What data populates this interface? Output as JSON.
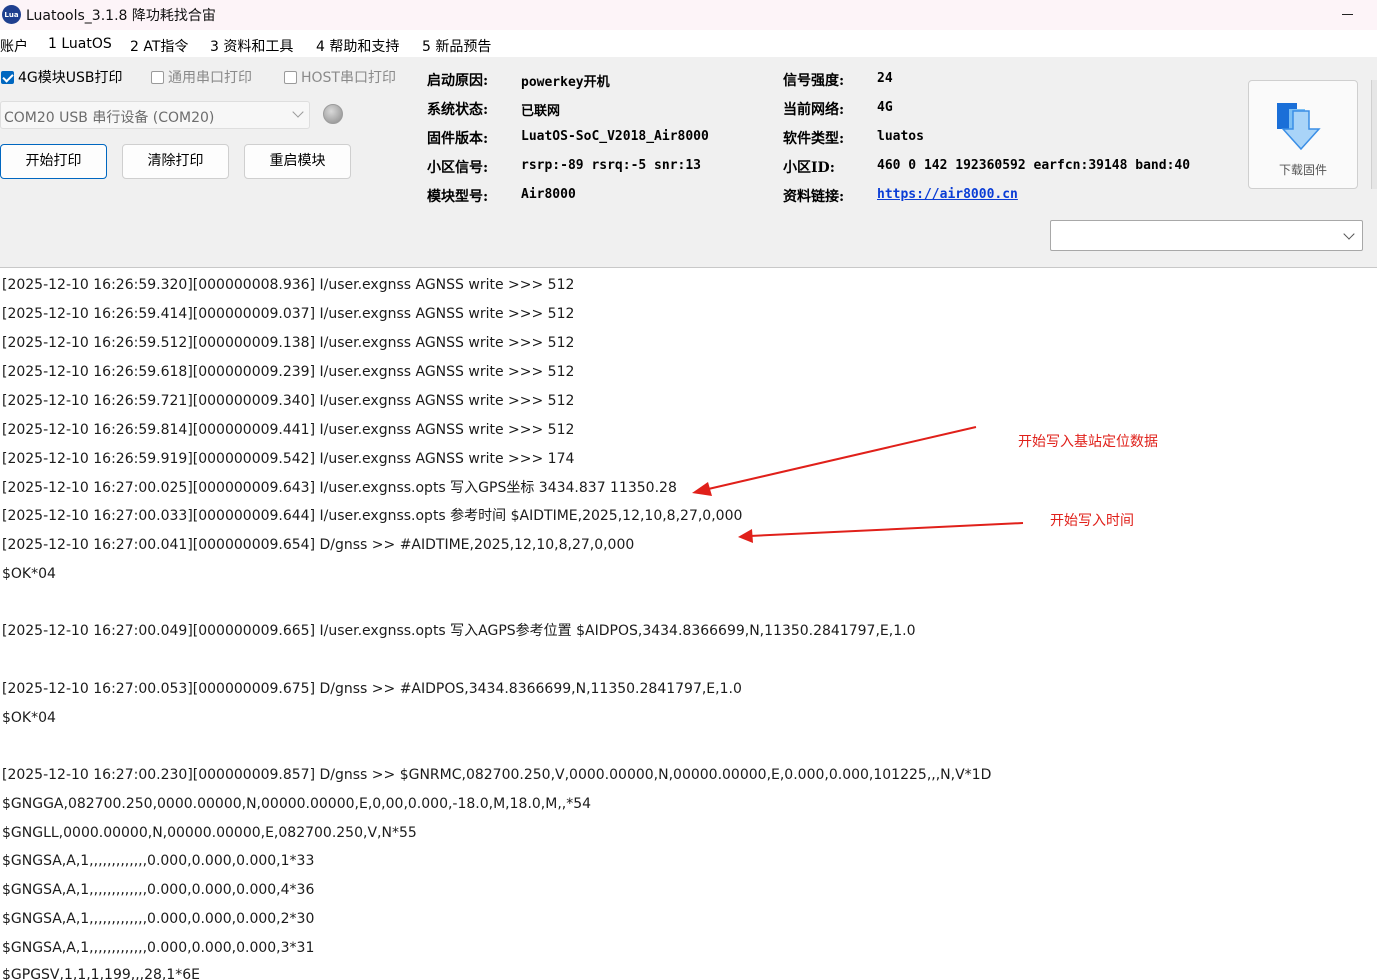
{
  "window": {
    "title": "Luatools_3.1.8 降功耗找合宙",
    "icon_text": "Lua"
  },
  "menu": [
    "账户",
    "1 LuatOS",
    "2 AT指令",
    "3 资料和工具",
    "4 帮助和支持",
    "5 新品预告"
  ],
  "print_options": [
    {
      "label": "4G模块USB打印",
      "checked": true,
      "enabled": true
    },
    {
      "label": "通用串口打印",
      "checked": false,
      "enabled": false
    },
    {
      "label": "HOST串口打印",
      "checked": false,
      "enabled": false
    }
  ],
  "port_select": {
    "value": "COM20 USB 串行设备 (COM20)"
  },
  "buttons": {
    "start": "开始打印",
    "clear": "清除打印",
    "restart": "重启模块",
    "download": "下载固件"
  },
  "info": {
    "boot_reason": {
      "label": "启动原因:",
      "value": "powerkey开机"
    },
    "system_state": {
      "label": "系统状态:",
      "value": "已联网"
    },
    "firmware": {
      "label": "固件版本:",
      "value": "LuatOS-SoC_V2018_Air8000"
    },
    "cell_signal": {
      "label": "小区信号:",
      "value": "rsrp:-89 rsrq:-5 snr:13"
    },
    "module_model": {
      "label": "模块型号:",
      "value": "Air8000"
    },
    "signal_strength": {
      "label": "信号强度:",
      "value": "24"
    },
    "network": {
      "label": "当前网络:",
      "value": "4G"
    },
    "software_type": {
      "label": "软件类型:",
      "value": "luatos"
    },
    "cell_id": {
      "label": "小区ID:",
      "value": "460 0 142 192360592 earfcn:39148 band:40"
    },
    "docs_link": {
      "label": "资料链接:",
      "value": "https://air8000.cn"
    }
  },
  "log_lines": [
    "[2025-12-10 16:26:59.320][000000008.936] I/user.exgnss AGNSS write >>> 512",
    "[2025-12-10 16:26:59.414][000000009.037] I/user.exgnss AGNSS write >>> 512",
    "[2025-12-10 16:26:59.512][000000009.138] I/user.exgnss AGNSS write >>> 512",
    "[2025-12-10 16:26:59.618][000000009.239] I/user.exgnss AGNSS write >>> 512",
    "[2025-12-10 16:26:59.721][000000009.340] I/user.exgnss AGNSS write >>> 512",
    "[2025-12-10 16:26:59.814][000000009.441] I/user.exgnss AGNSS write >>> 512",
    "[2025-12-10 16:26:59.919][000000009.542] I/user.exgnss AGNSS write >>> 174",
    "[2025-12-10 16:27:00.025][000000009.643] I/user.exgnss.opts 写入GPS坐标 3434.837 11350.28",
    "[2025-12-10 16:27:00.033][000000009.644] I/user.exgnss.opts 参考时间 $AIDTIME,2025,12,10,8,27,0,000",
    "[2025-12-10 16:27:00.041][000000009.654] D/gnss >> #AIDTIME,2025,12,10,8,27,0,000",
    "$OK*04",
    "",
    "[2025-12-10 16:27:00.049][000000009.665] I/user.exgnss.opts 写入AGPS参考位置 $AIDPOS,3434.8366699,N,11350.2841797,E,1.0",
    "",
    "[2025-12-10 16:27:00.053][000000009.675] D/gnss >> #AIDPOS,3434.8366699,N,11350.2841797,E,1.0",
    "$OK*04",
    "",
    "[2025-12-10 16:27:00.230][000000009.857] D/gnss >> $GNRMC,082700.250,V,0000.00000,N,00000.00000,E,0.000,0.000,101225,,,N,V*1D",
    "$GNGGA,082700.250,0000.00000,N,00000.00000,E,0,00,0.000,-18.0,M,18.0,M,,*54",
    "$GNGLL,0000.00000,N,00000.00000,E,082700.250,V,N*55",
    "$GNGSA,A,1,,,,,,,,,,,,,0.000,0.000,0.000,1*33",
    "$GNGSA,A,1,,,,,,,,,,,,,0.000,0.000,0.000,4*36",
    "$GNGSA,A,1,,,,,,,,,,,,,0.000,0.000,0.000,2*30",
    "$GNGSA,A,1,,,,,,,,,,,,,0.000,0.000,0.000,3*31",
    "$GPGSV,1,1,1,199,,,28,1*6E"
  ],
  "annotations": {
    "base_station": "开始写入基站定位数据",
    "time": "开始写入时间",
    "color": "#e0201a"
  },
  "colors": {
    "accent": "#0067c0",
    "link": "#0a3dd6",
    "download_icon": "#3a8ee6"
  }
}
